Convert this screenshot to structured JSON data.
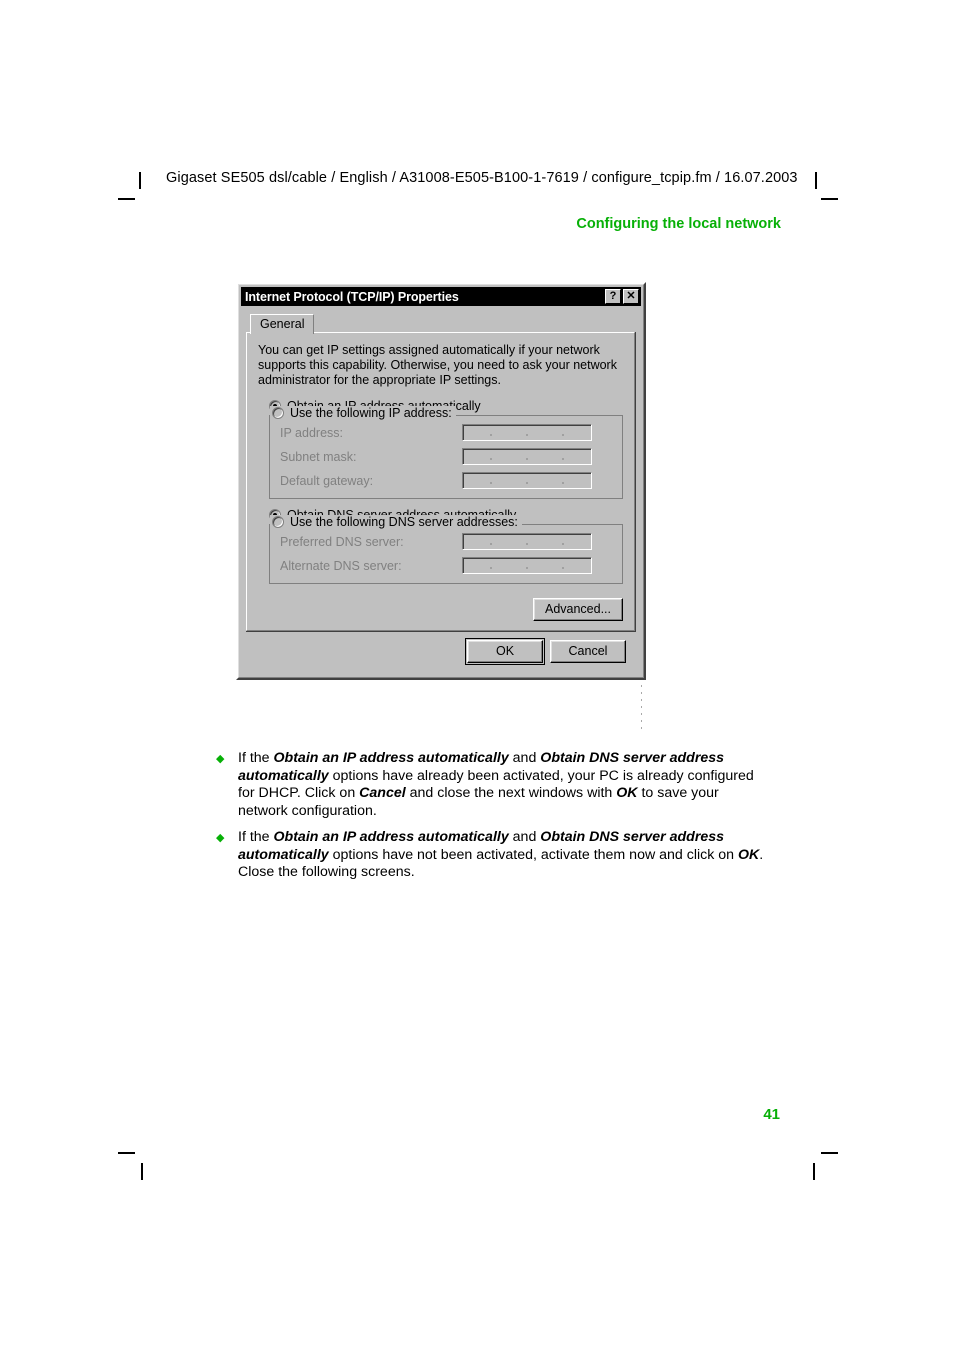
{
  "page": {
    "header_line": "Gigaset SE505 dsl/cable / English / A31008-E505-B100-1-7619 / configure_tcpip.fm / 16.07.2003",
    "section_heading": "Configuring the local network",
    "page_number": "41",
    "accent_color": "#07b007"
  },
  "dialog": {
    "title": "Internet Protocol (TCP/IP) Properties",
    "help_button": "?",
    "close_button": "✕",
    "tabs": [
      {
        "label": "General",
        "active": true
      }
    ],
    "description": "You can get IP settings assigned automatically if your network supports this capability. Otherwise, you need to ask your network administrator for the appropriate IP settings.",
    "ip_section": {
      "auto_option": {
        "label": "Obtain an IP address automatically",
        "selected": true
      },
      "manual_option": {
        "label": "Use the following IP address:",
        "selected": false
      },
      "fields": [
        {
          "label": "IP address:",
          "value": "",
          "enabled": false
        },
        {
          "label": "Subnet mask:",
          "value": "",
          "enabled": false
        },
        {
          "label": "Default gateway:",
          "value": "",
          "enabled": false
        }
      ]
    },
    "dns_section": {
      "auto_option": {
        "label": "Obtain DNS server address automatically",
        "selected": true
      },
      "manual_option": {
        "label": "Use the following DNS server addresses:",
        "selected": false
      },
      "fields": [
        {
          "label": "Preferred DNS server:",
          "value": "",
          "enabled": false
        },
        {
          "label": "Alternate DNS server:",
          "value": "",
          "enabled": false
        }
      ]
    },
    "buttons": {
      "advanced": "Advanced...",
      "ok": "OK",
      "cancel": "Cancel"
    }
  },
  "bullets": [
    {
      "marker": "◆",
      "parts": [
        {
          "text": "If the ",
          "emphasis": false
        },
        {
          "text": "Obtain an IP address automatically",
          "emphasis": true
        },
        {
          "text": " and ",
          "emphasis": false
        },
        {
          "text": "Obtain DNS server address automatically",
          "emphasis": true
        },
        {
          "text": " options have already been activated, your PC is already configured for DHCP. Click on ",
          "emphasis": false
        },
        {
          "text": "Cancel",
          "emphasis": true
        },
        {
          "text": " and close the next windows with ",
          "emphasis": false
        },
        {
          "text": "OK",
          "emphasis": true
        },
        {
          "text": " to save your network configuration.",
          "emphasis": false
        }
      ]
    },
    {
      "marker": "◆",
      "parts": [
        {
          "text": "If the ",
          "emphasis": false
        },
        {
          "text": "Obtain an IP address automatically",
          "emphasis": true
        },
        {
          "text": " and ",
          "emphasis": false
        },
        {
          "text": "Obtain DNS server address automatically",
          "emphasis": true
        },
        {
          "text": " options have not been activated, activate them now and click on ",
          "emphasis": false
        },
        {
          "text": "OK",
          "emphasis": true
        },
        {
          "text": ". Close the following screens.",
          "emphasis": false
        }
      ]
    }
  ]
}
